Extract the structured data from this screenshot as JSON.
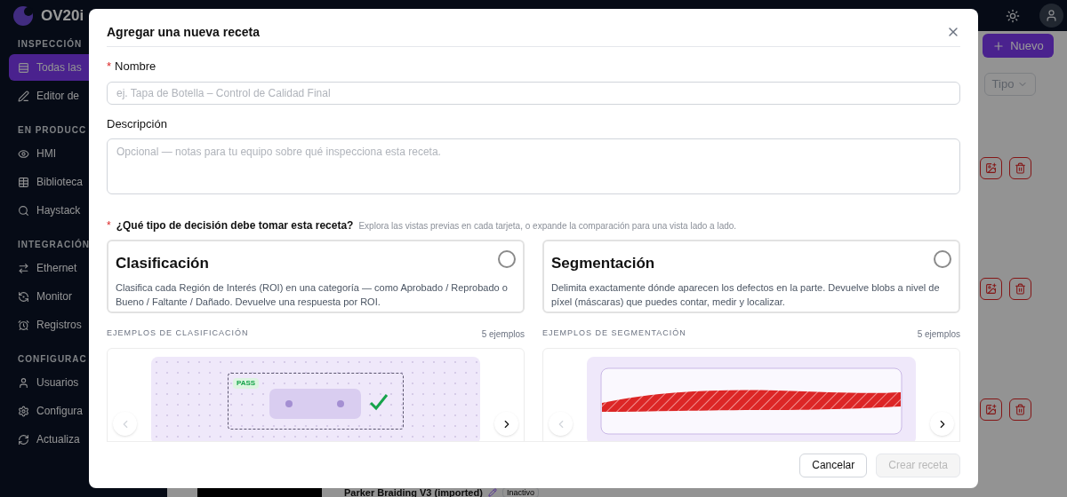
{
  "sidebar": {
    "brand": "OV20i",
    "sections": [
      {
        "heading": "INSPECCIÓN",
        "items": [
          {
            "label": "Todas las",
            "selected": true
          },
          {
            "label": "Editor de",
            "selected": false
          }
        ]
      },
      {
        "heading": "EN PRODUCC",
        "items": [
          {
            "label": "HMI",
            "selected": false
          },
          {
            "label": "Biblioteca",
            "selected": false
          },
          {
            "label": "Haystack",
            "selected": false
          }
        ]
      },
      {
        "heading": "INTEGRACIÓN",
        "items": [
          {
            "label": "Ethernet",
            "selected": false
          },
          {
            "label": "Monitor",
            "selected": false
          },
          {
            "label": "Registros",
            "selected": false
          }
        ]
      },
      {
        "heading": "CONFIGURAC",
        "items": [
          {
            "label": "Usuarios",
            "selected": false
          },
          {
            "label": "Configura",
            "selected": false
          },
          {
            "label": "Actualiza",
            "selected": false
          }
        ]
      }
    ]
  },
  "main": {
    "new_button": "Nuevo",
    "type_filter": "Tipo",
    "recipe_title": "Parker Braiding V3 (imported)",
    "recipe_status": "Inactivo"
  },
  "modal": {
    "title": "Agregar una nueva receta",
    "fields": [
      {
        "label": "Nombre",
        "required_mark": "*",
        "placeholder": "ej. Tapa de Botella – Control de Calidad Final",
        "kind": "input"
      },
      {
        "label": "Descripción",
        "placeholder": "Opcional — notas para tu equipo sobre qué inspecciona esta receta.",
        "kind": "textarea"
      }
    ],
    "question": {
      "label": "¿Qué tipo de decisión debe tomar esta receta?",
      "required_mark": "*",
      "hint": "Explora las vistas previas en cada tarjeta, o expande la comparación para una vista lado a lado."
    },
    "options": [
      {
        "title": "Clasificación",
        "description": "Clasifica cada Región de Interés (ROI) en una categoría — como Aprobado / Reprobado o Bueno / Faltante / Dañado. Devuelve una respuesta por ROI.",
        "selected": false
      },
      {
        "title": "Segmentación",
        "description": "Delimita exactamente dónde aparecen los defectos en la parte. Devuelve blobs a nivel de píxel (máscaras) que puedes contar, medir y localizar.",
        "selected": false
      }
    ],
    "examples": [
      {
        "heading": "EJEMPLOS DE CLASIFICACIÓN",
        "count": "5 ejemplos",
        "kind": "classification",
        "badge": "PASS"
      },
      {
        "heading": "EJEMPLOS DE SEGMENTACIÓN",
        "count": "5 ejemplos",
        "kind": "segmentation"
      }
    ],
    "buttons": [
      {
        "label": "Cancelar",
        "disabled": false
      },
      {
        "label": "Crear receta",
        "disabled": true
      }
    ]
  }
}
